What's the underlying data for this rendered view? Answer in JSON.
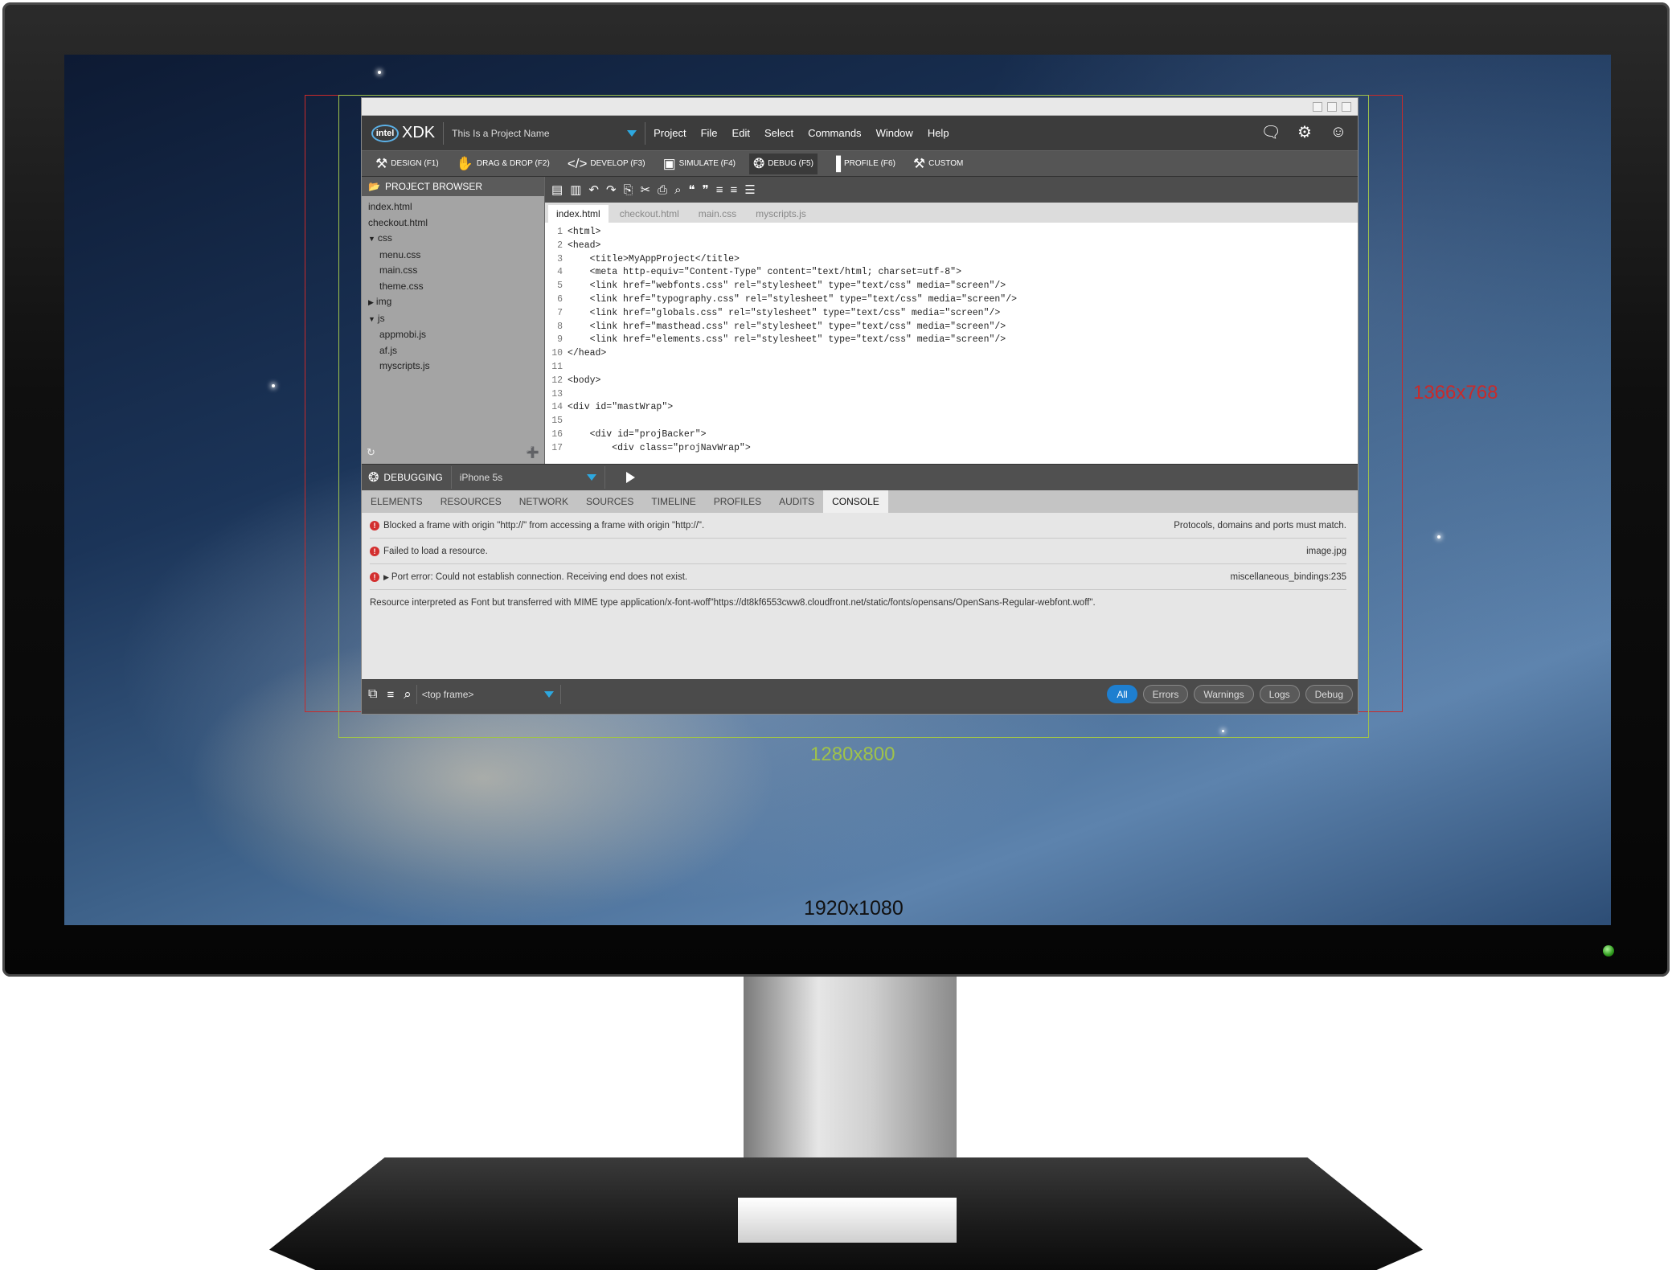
{
  "guides": {
    "res_1366": "1366x768",
    "res_1280": "1280x800",
    "res_1920": "1920x1080"
  },
  "app": {
    "brand": {
      "intel": "intel",
      "product": "XDK"
    },
    "project_name": "This Is a Project Name",
    "menu": [
      "Project",
      "File",
      "Edit",
      "Select",
      "Commands",
      "Window",
      "Help"
    ],
    "modes": [
      "DESIGN (F1)",
      "DRAG & DROP (F2)",
      "DEVELOP (F3)",
      "SIMULATE (F4)",
      "DEBUG (F5)",
      "PROFILE (F6)",
      "CUSTOM"
    ],
    "project_browser": {
      "title": "PROJECT BROWSER",
      "items": [
        "index.html",
        "checkout.html",
        "css",
        "menu.css",
        "main.css",
        "theme.css",
        "img",
        "js",
        "appmobi.js",
        "af.js",
        "myscripts.js"
      ]
    },
    "editor_tabs": [
      "index.html",
      "checkout.html",
      "main.css",
      "myscripts.js"
    ],
    "code_lines": [
      {
        "n": "1",
        "t": "<html>"
      },
      {
        "n": "2",
        "t": "<head>"
      },
      {
        "n": "3",
        "t": "    <title>MyAppProject</title>"
      },
      {
        "n": "4",
        "t": "    <meta http-equiv=\"Content-Type\" content=\"text/html; charset=utf-8\">"
      },
      {
        "n": "5",
        "t": "    <link href=\"webfonts.css\" rel=\"stylesheet\" type=\"text/css\" media=\"screen\"/>"
      },
      {
        "n": "6",
        "t": "    <link href=\"typography.css\" rel=\"stylesheet\" type=\"text/css\" media=\"screen\"/>"
      },
      {
        "n": "7",
        "t": "    <link href=\"globals.css\" rel=\"stylesheet\" type=\"text/css\" media=\"screen\"/>"
      },
      {
        "n": "8",
        "t": "    <link href=\"masthead.css\" rel=\"stylesheet\" type=\"text/css\" media=\"screen\"/>"
      },
      {
        "n": "9",
        "t": "    <link href=\"elements.css\" rel=\"stylesheet\" type=\"text/css\" media=\"screen\"/>"
      },
      {
        "n": "10",
        "t": "</head>"
      },
      {
        "n": "11",
        "t": ""
      },
      {
        "n": "12",
        "t": "<body>"
      },
      {
        "n": "13",
        "t": ""
      },
      {
        "n": "14",
        "t": "<div id=\"mastWrap\">"
      },
      {
        "n": "15",
        "t": ""
      },
      {
        "n": "16",
        "t": "    <div id=\"projBacker\">"
      },
      {
        "n": "17",
        "t": "        <div class=\"projNavWrap\">"
      }
    ],
    "debugging": {
      "title": "DEBUGGING",
      "device": "iPhone 5s",
      "tabs": [
        "ELEMENTS",
        "RESOURCES",
        "NETWORK",
        "SOURCES",
        "TIMELINE",
        "PROFILES",
        "AUDITS",
        "CONSOLE"
      ],
      "active_tab": "CONSOLE",
      "console": [
        {
          "msg": "Blocked a frame with origin  \"http://\" from accessing a frame with origin \"http://\".",
          "src": "Protocols, domains and ports must match."
        },
        {
          "msg": "Failed to load a resource.",
          "src": "image.jpg"
        },
        {
          "msg": "Port error: Could not establish connection. Receiving end does not exist.",
          "src": "miscellaneous_bindings:235"
        },
        {
          "msg": "Resource interpreted as Font but transferred with MIME type application/x-font-woff\"https://dt8kf6553cww8.cloudfront.net/static/fonts/opensans/OpenSans-Regular-webfont.woff\".",
          "src": ""
        }
      ],
      "frame": "<top frame>",
      "filters": [
        "All",
        "Errors",
        "Warnings",
        "Logs",
        "Debug"
      ]
    }
  },
  "colors": {
    "accent": "#2da8e0",
    "filter_active": "#1e7fd0",
    "error": "#d32f2f",
    "guide_red": "#c92a2a",
    "guide_green": "#9fc24b"
  }
}
